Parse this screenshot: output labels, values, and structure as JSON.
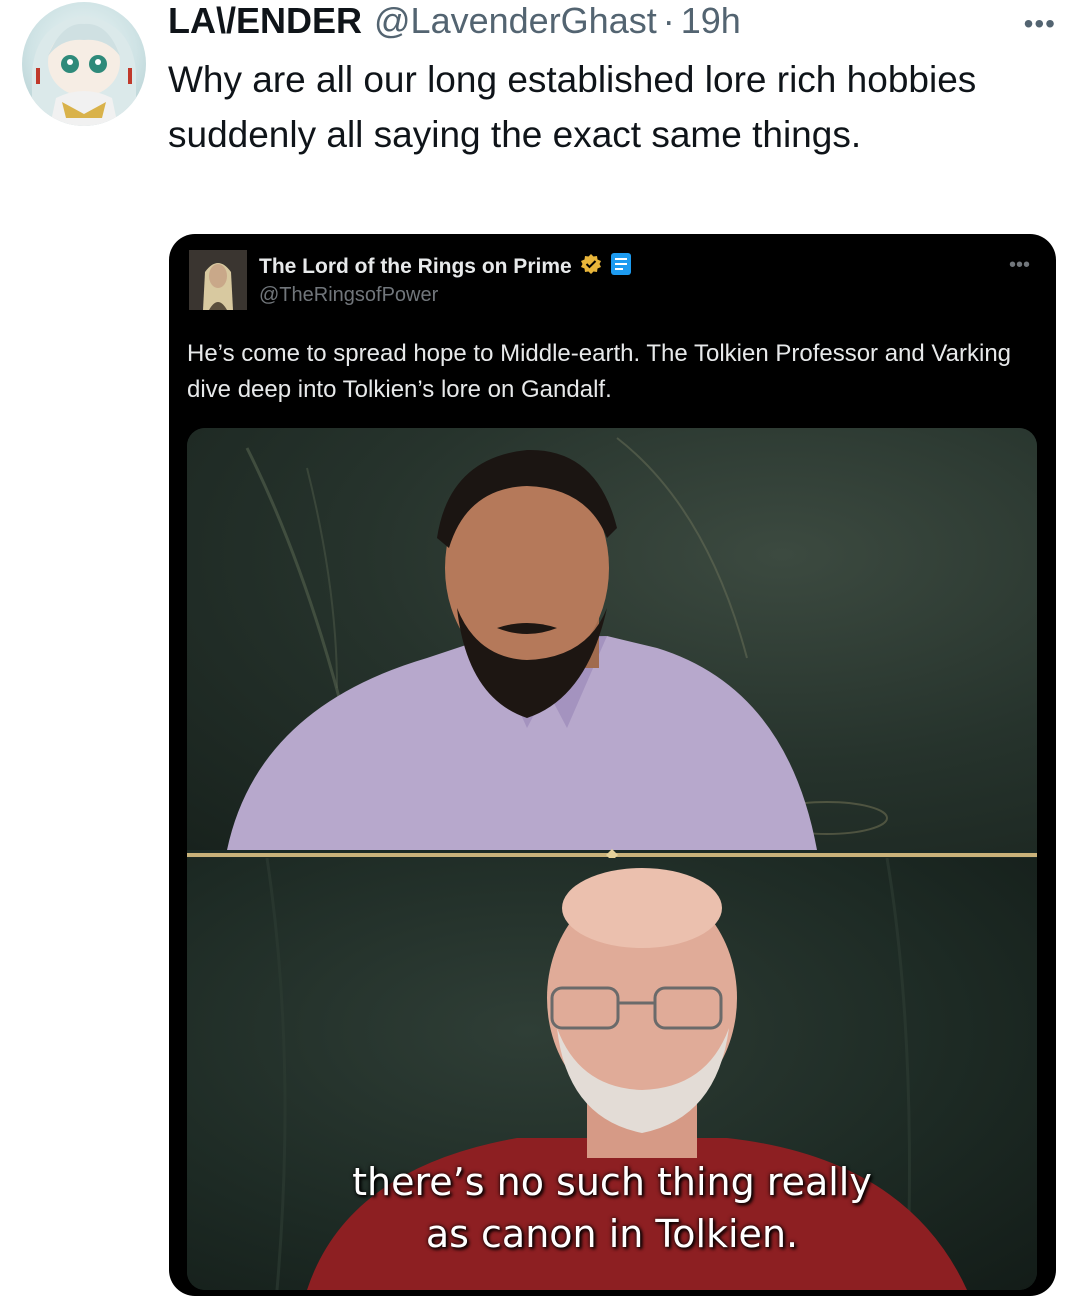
{
  "post": {
    "display_name": "LA\\/ENDER",
    "handle": "@LavenderGhast",
    "separator": "·",
    "time": "19h",
    "more_icon": "more-icon",
    "text": "Why are all our long established lore rich hobbies suddenly all saying the exact same things."
  },
  "quoted": {
    "display_name": "The Lord of the Rings on Prime",
    "handle": "@TheRingsofPower",
    "badges": [
      "verified-badge-icon",
      "affiliate-badge-icon"
    ],
    "badge_color": "#e8b53a",
    "affiliate_color": "#1d9bf0",
    "text": "He’s come to spread hope to Middle-earth. The Tolkien Professor and Varking dive deep into Tolkien’s lore on Gandalf.",
    "media": {
      "subtitle_line1": "there’s no such thing really",
      "subtitle_line2": "as canon in Tolkien."
    }
  }
}
